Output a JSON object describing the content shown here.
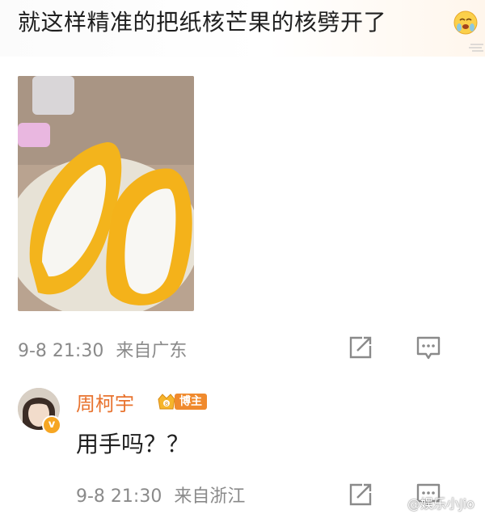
{
  "post": {
    "text": "就这样精准的把纸核芒果的核劈开了",
    "emoji": "crying-face-emoji",
    "timestamp": "9-8 21:30",
    "location": "来自广东"
  },
  "comment": {
    "username": "周柯宇",
    "badge_label": "博主",
    "verified_mark": "v",
    "text": "用手吗？？",
    "timestamp": "9-8 21:30",
    "location": "来自浙江"
  },
  "watermark": "@娱乐小Jio",
  "colors": {
    "username": "#e8732f",
    "meta": "#8a8a8a",
    "badge": "#f08a2d"
  },
  "icons": [
    "share-icon",
    "comment-icon",
    "crying-face-emoji",
    "weibo-logo-icon"
  ]
}
